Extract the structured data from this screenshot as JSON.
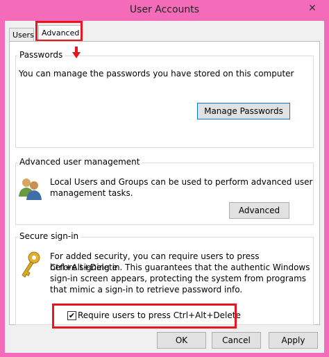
{
  "window": {
    "title": "User Accounts"
  },
  "tabs": [
    {
      "label": "Users"
    },
    {
      "label": "Advanced"
    }
  ],
  "passwords": {
    "label": "Passwords",
    "description": "You can manage the passwords you have stored on this computer",
    "button": "Manage Passwords"
  },
  "advanced_user_mgmt": {
    "label": "Advanced user management",
    "line1": "Local Users and Groups can be used to perform advanced user",
    "line2": "management tasks.",
    "button": "Advanced"
  },
  "secure_signin": {
    "label": "Secure sign-in",
    "lines": [
      "For added security, you can require users to press Ctrl+Alt+Delete",
      "before signing in. This guarantees that the authentic Windows",
      "sign-in screen appears, protecting the system from programs",
      "that mimic a sign-in to retrieve password info."
    ],
    "checkbox_label": "Require users to press Ctrl+Alt+Delete",
    "checkbox_checked": true
  },
  "footer": {
    "ok": "OK",
    "cancel": "Cancel",
    "apply": "Apply"
  },
  "colors": {
    "highlight": "#e8141e",
    "background": "#f46bb9"
  },
  "icons": {
    "close": "close-icon",
    "users": "users-icon",
    "key": "key-icon",
    "arrow": "arrow-down-icon"
  }
}
